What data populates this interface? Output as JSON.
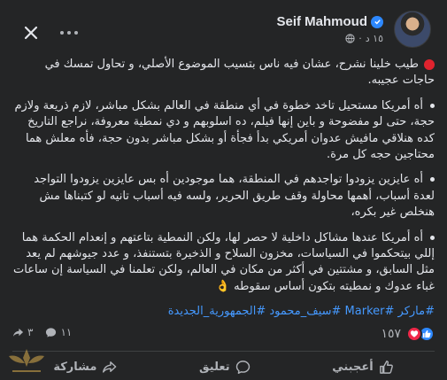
{
  "header": {
    "author_name": "Seif Mahmoud",
    "time": "١٥ د",
    "separator": "·",
    "close_icon": "close-icon",
    "more_icon": "more-horizontal-icon",
    "verified_icon": "verified-badge-icon",
    "audience_icon": "globe-icon"
  },
  "post": {
    "intro": "طيب خلينا نشرح، عشان فيه ناس بتسيب الموضوع الأصلي، و تحاول تمسك في حاجات عجيبه.",
    "point1": "أه أمريكا مستحيل تاخد خطوة في أي منطقة في العالم بشكل مباشر، لازم ذريعة ولازم حجة، حتى لو مفضوحة و باين إنها فيلم، ده اسلوبهم و دي نمطية معروفة، نراجع التاريخ كده هنلاقي مافيش عدوان أمريكي بدأ فجأة أو بشكل مباشر بدون حجة، فأه معلش هما محتاجين حجه كل مرة.",
    "point2": "أه عايزين يزودوا تواجدهم في المنطقة، هما موجودين أه بس عايزين يزودوا التواجد لعدة أسباب، أهمها محاولة وقف طريق الحرير، ولسه فيه أسباب تانيه لو كتبناها مش هنخلص غير بكره،",
    "point3": "أه أمريكا عندها مشاكل داخلية لا حصر لها، ولكن النمطية بتاعتهم و إنعدام الحكمة هما إللي بيتحكموا في السياسات، مخزون السلاح و الذخيرة بتستنفذ، و عدد جيوشهم لم يعد مثل السابق، و مشتتين في أكثر من مكان في العالم، ولكن تعلمنا في السياسة إن ساعات غباء عدوك و نمطيته بتكون أساس سقوطه",
    "point3_emoji": "👌",
    "hashtags": [
      "#ماركر",
      "#Marker",
      "#سيف_محمود",
      "#الجمهورية_الجديدة"
    ]
  },
  "reactions": {
    "count": "١٥٧",
    "comments": "١١",
    "shares": "٣",
    "colors": {
      "like": "#2d88ff",
      "love": "#f02849"
    }
  },
  "actions": {
    "like_label": "أعجبني",
    "comment_label": "تعليق",
    "share_label": "مشاركة"
  }
}
